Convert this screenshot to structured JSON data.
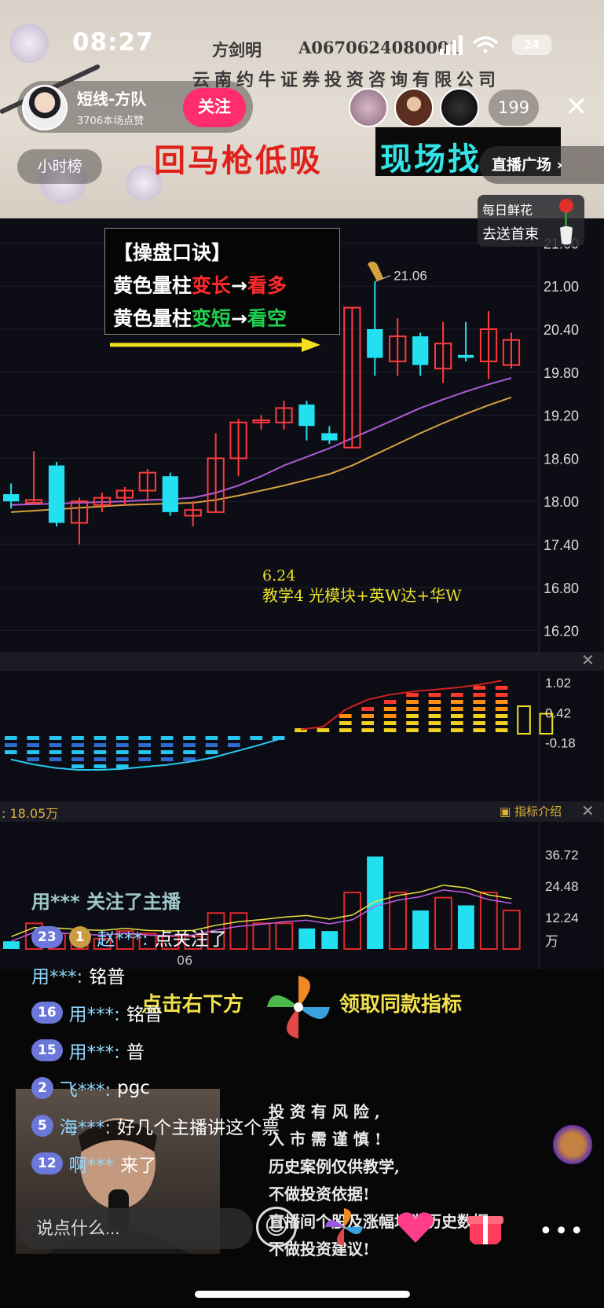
{
  "status_bar": {
    "time": "08:27",
    "battery": "24"
  },
  "stream_header": {
    "analyst_name": "方剑明",
    "license_code": "A0670624080001",
    "company": "云南约牛证券投资咨询有限公司"
  },
  "host": {
    "name": "短线-方队",
    "likes": "3706本场点赞",
    "follow_label": "关注"
  },
  "viewer_count": "199",
  "hour_rank": "小时榜",
  "plaza": "直播广场",
  "slogan": {
    "part1": "回马枪低吸",
    "part2": "现场找"
  },
  "flower": {
    "line1": "每日鲜花",
    "line2": "去送首束"
  },
  "tips": {
    "title": "【操盘口诀】",
    "line1": {
      "a": "黄色量柱",
      "b": "变长",
      "c": "→",
      "d": "看多"
    },
    "line2": {
      "a": "黄色量柱",
      "b": "变短",
      "c": "→",
      "d": "看空"
    }
  },
  "annotation": {
    "date": "6.24",
    "text": "教学4 光模块+英W达+华W"
  },
  "chart_data": [
    {
      "type": "candlestick",
      "y_ticks": [
        "21.60",
        "21.00",
        "20.40",
        "19.80",
        "19.20",
        "18.60",
        "18.00",
        "17.40",
        "16.80",
        "16.20"
      ],
      "ylim": [
        15.9,
        21.9
      ],
      "peak_label": "21.06",
      "candles": [
        {
          "o": 18.1,
          "c": 18.0,
          "h": 18.25,
          "l": 17.9,
          "color": "cyan"
        },
        {
          "o": 17.98,
          "c": 18.02,
          "h": 18.7,
          "l": 17.95,
          "color": "red"
        },
        {
          "o": 18.5,
          "c": 17.7,
          "h": 18.55,
          "l": 17.65,
          "color": "cyan"
        },
        {
          "o": 17.7,
          "c": 18.0,
          "h": 18.05,
          "l": 17.4,
          "color": "red"
        },
        {
          "o": 17.95,
          "c": 18.05,
          "h": 18.12,
          "l": 17.85,
          "color": "red"
        },
        {
          "o": 18.05,
          "c": 18.15,
          "h": 18.2,
          "l": 17.95,
          "color": "red"
        },
        {
          "o": 18.15,
          "c": 18.4,
          "h": 18.45,
          "l": 18.0,
          "color": "red"
        },
        {
          "o": 18.35,
          "c": 17.85,
          "h": 18.4,
          "l": 17.8,
          "color": "cyan"
        },
        {
          "o": 17.8,
          "c": 17.88,
          "h": 18.0,
          "l": 17.65,
          "color": "red"
        },
        {
          "o": 17.85,
          "c": 18.6,
          "h": 18.95,
          "l": 17.85,
          "color": "red"
        },
        {
          "o": 18.6,
          "c": 19.1,
          "h": 19.15,
          "l": 18.35,
          "color": "red"
        },
        {
          "o": 19.1,
          "c": 19.13,
          "h": 19.2,
          "l": 19.0,
          "color": "red"
        },
        {
          "o": 19.1,
          "c": 19.3,
          "h": 19.4,
          "l": 19.0,
          "color": "red"
        },
        {
          "o": 19.35,
          "c": 19.05,
          "h": 19.4,
          "l": 18.85,
          "color": "cyan"
        },
        {
          "o": 18.95,
          "c": 18.85,
          "h": 19.05,
          "l": 18.8,
          "color": "cyan"
        },
        {
          "o": 18.75,
          "c": 20.7,
          "h": 20.7,
          "l": 18.75,
          "color": "red"
        },
        {
          "o": 20.4,
          "c": 20.0,
          "h": 21.06,
          "l": 19.75,
          "color": "cyan"
        },
        {
          "o": 19.95,
          "c": 20.3,
          "h": 20.55,
          "l": 19.75,
          "color": "red"
        },
        {
          "o": 20.3,
          "c": 19.9,
          "h": 20.35,
          "l": 19.75,
          "color": "cyan"
        },
        {
          "o": 19.85,
          "c": 20.2,
          "h": 20.5,
          "l": 19.65,
          "color": "red"
        },
        {
          "o": 20.0,
          "c": 20.04,
          "h": 20.5,
          "l": 19.95,
          "color": "cyan"
        },
        {
          "o": 19.95,
          "c": 20.4,
          "h": 20.65,
          "l": 19.7,
          "color": "red"
        },
        {
          "o": 19.9,
          "c": 20.25,
          "h": 20.35,
          "l": 19.85,
          "color": "red"
        }
      ],
      "ma_purple": [
        17.95,
        17.96,
        17.97,
        17.98,
        17.99,
        18.0,
        18.02,
        18.03,
        18.05,
        18.12,
        18.22,
        18.35,
        18.5,
        18.62,
        18.74,
        18.88,
        19.02,
        19.16,
        19.3,
        19.42,
        19.53,
        19.63,
        19.72
      ],
      "ma_orange": [
        17.85,
        17.87,
        17.89,
        17.91,
        17.93,
        17.95,
        17.96,
        17.97,
        17.98,
        18.02,
        18.08,
        18.15,
        18.22,
        18.3,
        18.38,
        18.5,
        18.65,
        18.8,
        18.95,
        19.09,
        19.22,
        19.34,
        19.45
      ]
    },
    {
      "type": "bar",
      "y_ticks": [
        "1.02",
        "0.42",
        "-0.18"
      ],
      "values": [
        -0.45,
        -0.55,
        -0.62,
        -0.66,
        -0.66,
        -0.64,
        -0.6,
        -0.56,
        -0.5,
        -0.42,
        -0.3,
        -0.18,
        -0.05,
        0.02,
        0.08,
        0.42,
        0.62,
        0.72,
        0.78,
        0.82,
        0.86,
        0.92,
        1.0,
        0.55,
        0.4
      ]
    },
    {
      "type": "bar",
      "unit": "万",
      "volume_label": ": 18.05万",
      "y_ticks": [
        "36.72",
        "24.48",
        "12.24"
      ],
      "values": [
        3,
        10,
        6,
        4,
        4,
        7,
        6,
        5,
        5,
        14,
        14,
        10,
        10,
        8,
        7,
        22,
        36,
        22,
        15,
        20,
        17,
        22,
        15
      ],
      "colors": [
        "cyan",
        "red",
        "red",
        "red",
        "red",
        "red",
        "red",
        "red",
        "red",
        "red",
        "red",
        "red",
        "red",
        "cyan",
        "cyan",
        "red",
        "cyan",
        "red",
        "cyan",
        "red",
        "cyan",
        "red",
        "red"
      ]
    }
  ],
  "indicator_intro": "指标介绍",
  "date_label": "06",
  "follow_notice": "用*** 关注了主播",
  "chat": [
    {
      "level": "23",
      "fan": "1",
      "user": "赵***:",
      "msg": "点关注了"
    },
    {
      "level": "",
      "user": "用***:",
      "msg": "铭普"
    },
    {
      "level": "16",
      "user": "用***:",
      "msg": "铭普"
    },
    {
      "level": "15",
      "user": "用***:",
      "msg": "普"
    },
    {
      "level": "2",
      "user": "飞***:",
      "msg": "pgc"
    },
    {
      "level": "5",
      "user": "海***:",
      "msg": "好几个主播讲这个票"
    },
    {
      "level": "12",
      "user": "啊***",
      "msg": "来了"
    }
  ],
  "promo": {
    "left": "点击右下方",
    "right": "领取同款指标"
  },
  "disclaimer": [
    "投 资 有 风 险 ,",
    "入 市 需 谨 慎 !",
    "历史案例仅供教学,",
    "不做投资依据!",
    "直播间个股及涨幅均为历史数据,",
    "不做投资建议!"
  ],
  "input_placeholder": "说点什么..."
}
